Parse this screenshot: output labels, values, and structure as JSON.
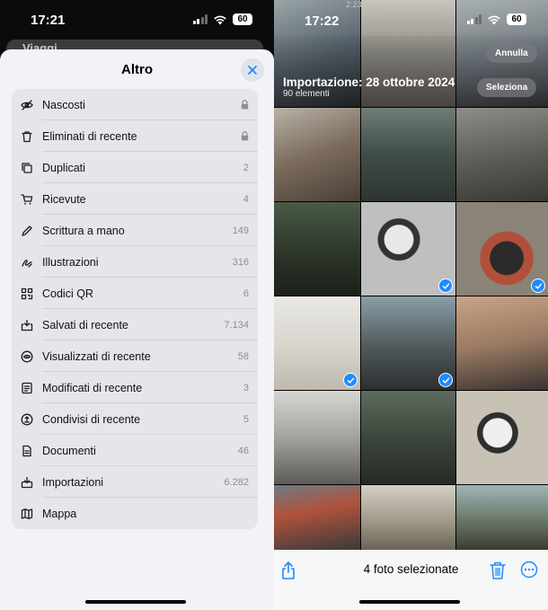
{
  "left": {
    "status": {
      "time": "17:21",
      "battery": "60"
    },
    "behind_title": "Viaggi",
    "sheet_title": "Altro",
    "items": [
      {
        "label": "Nascosti",
        "count": "",
        "locked": true,
        "icon": "eye-slash-icon"
      },
      {
        "label": "Eliminati di recente",
        "count": "",
        "locked": true,
        "icon": "trash-icon"
      },
      {
        "label": "Duplicati",
        "count": "2",
        "locked": false,
        "icon": "duplicate-icon"
      },
      {
        "label": "Ricevute",
        "count": "4",
        "locked": false,
        "icon": "cart-icon"
      },
      {
        "label": "Scrittura a mano",
        "count": "149",
        "locked": false,
        "icon": "pen-icon"
      },
      {
        "label": "Illustrazioni",
        "count": "316",
        "locked": false,
        "icon": "scribble-icon"
      },
      {
        "label": "Codici QR",
        "count": "6",
        "locked": false,
        "icon": "qr-icon"
      },
      {
        "label": "Salvati di recente",
        "count": "7.134",
        "locked": false,
        "icon": "save-tray-icon"
      },
      {
        "label": "Visualizzati di recente",
        "count": "58",
        "locked": false,
        "icon": "eye-circle-icon"
      },
      {
        "label": "Modificati di recente",
        "count": "3",
        "locked": false,
        "icon": "edit-doc-icon"
      },
      {
        "label": "Condivisi di recente",
        "count": "5",
        "locked": false,
        "icon": "share-circle-icon"
      },
      {
        "label": "Documenti",
        "count": "46",
        "locked": false,
        "icon": "document-icon"
      },
      {
        "label": "Importazioni",
        "count": "6.282",
        "locked": false,
        "icon": "import-tray-icon"
      },
      {
        "label": "Mappa",
        "count": "",
        "locked": false,
        "icon": "map-icon"
      }
    ]
  },
  "right": {
    "top_timestamp": "2:23",
    "status": {
      "time": "17:22",
      "battery": "60"
    },
    "import_title": "Importazione: 28 ottobre 2024",
    "import_count": "90 elementi",
    "cancel_label": "Annulla",
    "select_label": "Seleziona",
    "selection_text": "4 foto selezionate",
    "colors": {
      "accent": "#1f8bff"
    }
  }
}
